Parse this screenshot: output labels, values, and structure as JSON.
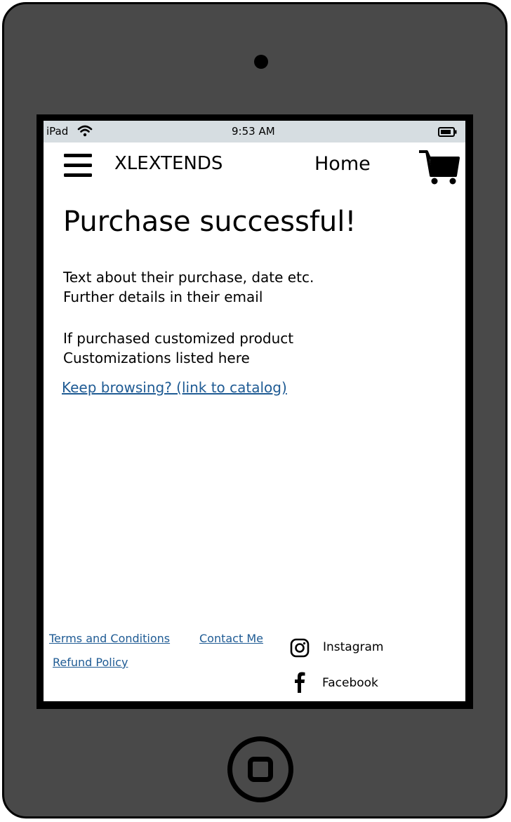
{
  "status_bar": {
    "device": "iPad",
    "time": "9:53 AM",
    "icons": [
      "wifi-icon",
      "battery-icon"
    ]
  },
  "header": {
    "brand": "XLEXTENDS",
    "nav_home": "Home",
    "icons": [
      "menu-icon",
      "cart-icon"
    ]
  },
  "main": {
    "title": "Purchase successful!",
    "purchase_lines": [
      "Text about their purchase, date etc.",
      "Further details in their email"
    ],
    "custom_lines": [
      "If purchased customized product",
      "Customizations listed here"
    ],
    "catalog_link": "Keep browsing? (link to catalog)"
  },
  "footer": {
    "terms": "Terms and Conditions",
    "contact": "Contact Me",
    "refund": "Refund Policy",
    "social": [
      {
        "icon": "instagram-icon",
        "label": "Instagram"
      },
      {
        "icon": "facebook-icon",
        "label": "Facebook"
      }
    ]
  },
  "colors": {
    "device_body": "#494949",
    "status_bar_bg": "#d6dde1",
    "link": "#1f5b94"
  }
}
